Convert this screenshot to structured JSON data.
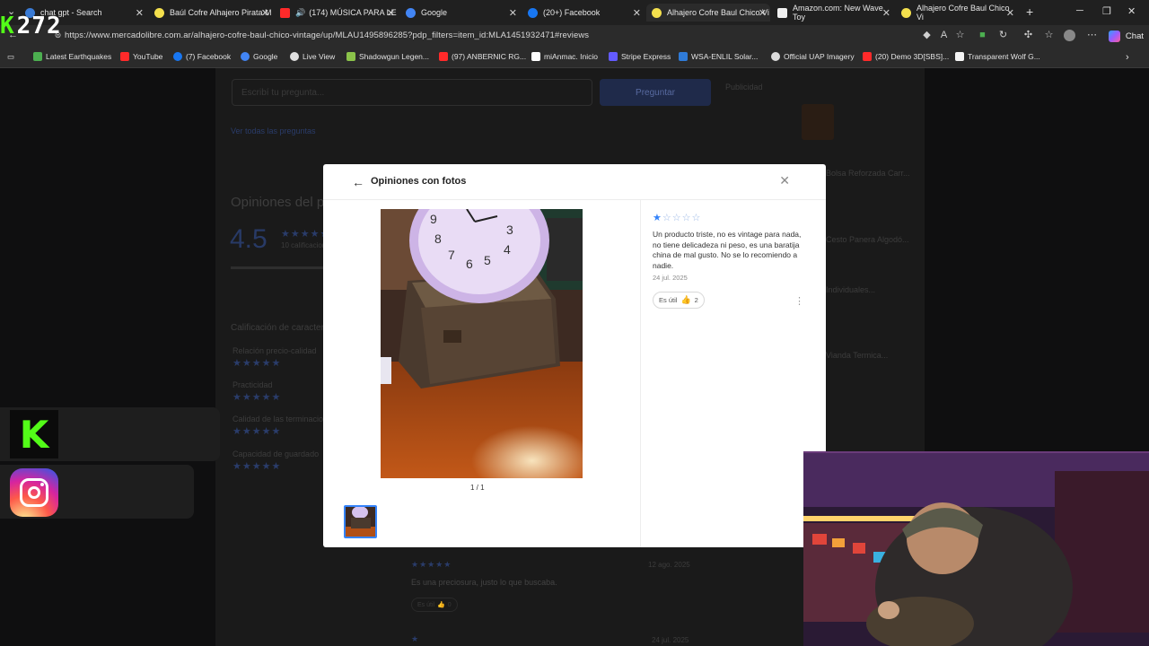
{
  "browser": {
    "tabs": [
      {
        "title": "chat gpt - Search",
        "color": "#3a7bd5"
      },
      {
        "title": "Baúl Cofre Alhajero Pirata M",
        "color": "#f4e04d"
      },
      {
        "title": "(174) MÚSICA PARA LE",
        "color": "#ff2a2a"
      },
      {
        "title": "Google",
        "color": "#4285f4"
      },
      {
        "title": "(20+) Facebook",
        "color": "#1877f2"
      },
      {
        "title": "Alhajero Cofre Baul Chico Vi",
        "color": "#f4e04d"
      },
      {
        "title": "Amazon.com: New Wave Toy",
        "color": "#f0f0f0"
      },
      {
        "title": "Alhajero Cofre Baul Chico Vi",
        "color": "#f4e04d"
      }
    ],
    "url": "https://www.mercadolibre.com.ar/alhajero-cofre-baul-chico-vintage/up/MLAU1495896285?pdp_filters=item_id:MLA1451932471#reviews",
    "chat_label": "Chat",
    "bookmarks": [
      {
        "label": "Latest Earthquakes",
        "color": "#4caf50"
      },
      {
        "label": "YouTube",
        "color": "#ff2a2a"
      },
      {
        "label": "(7) Facebook",
        "color": "#1877f2"
      },
      {
        "label": "Google",
        "color": "#4285f4"
      },
      {
        "label": "Live View",
        "color": "#e0e0e0"
      },
      {
        "label": "Shadowgun Legen...",
        "color": "#8bc34a"
      },
      {
        "label": "(97) ANBERNIC RG...",
        "color": "#ff2a2a"
      },
      {
        "label": "miAnmac. Inicio",
        "color": "#ffffff"
      },
      {
        "label": "Stripe Express",
        "color": "#635bff"
      },
      {
        "label": "WSA-ENLIL Solar...",
        "color": "#2f7bd8"
      },
      {
        "label": "Official UAP Imagery",
        "color": "#dddddd"
      },
      {
        "label": "(20) Demo 3D[SBS]...",
        "color": "#ff2a2a"
      },
      {
        "label": "Transparent Wolf G...",
        "color": "#f5f5f5"
      }
    ]
  },
  "stream_overlay": {
    "kick_count": "272"
  },
  "background_page": {
    "question_placeholder": "Escribí tu pregunta...",
    "ask_button": "Preguntar",
    "see_questions": "Ver todas las preguntas",
    "reviews_title": "Opiniones del producto",
    "rating": "4.5",
    "ratings_count": "10 calificaciones",
    "characteristics_title": "Calificación de características",
    "characteristics": [
      {
        "label": "Relación precio-calidad",
        "stars": "★★★★★"
      },
      {
        "label": "Practicidad",
        "stars": "★★★★★"
      },
      {
        "label": "Calidad de las terminaciones",
        "stars": "★★★★★"
      },
      {
        "label": "Capacidad de guardado",
        "stars": "★★★★★"
      }
    ],
    "publicidad": "Publicidad",
    "ads": [
      "Bolsa Reforzada Carr...",
      "Cesto Panera Algodó...",
      "Individuales...",
      "Vianda Termica..."
    ],
    "next_review": {
      "stars": "★★★★★",
      "date": "12 ago. 2025",
      "text": "Es una preciosura, justo lo que buscaba.",
      "useful": "Es útil",
      "count": "0"
    },
    "next_review2_date": "24 jul. 2025"
  },
  "modal": {
    "title": "Opiniones con fotos",
    "photo_counter": "1 / 1",
    "review": {
      "rating": 1,
      "stars_filled": "★",
      "stars_empty": "☆☆☆☆",
      "text": "Un producto triste, no es vintage para nada, no tiene delicadeza ni peso, es una baratija china de mal gusto. No se lo recomiendo a nadie.",
      "date": "24 jul. 2025",
      "useful_label": "Es útil",
      "useful_count": "2"
    }
  },
  "colors": {
    "accent": "#3483fa",
    "kick": "#53fc18"
  }
}
